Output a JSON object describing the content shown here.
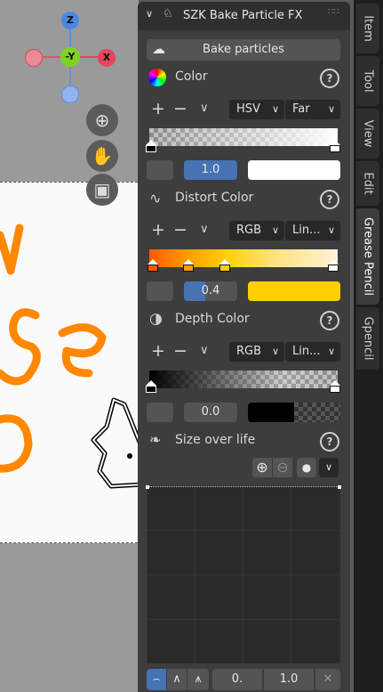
{
  "panel": {
    "title": "SZK Bake Particle FX",
    "bake_button": "Bake particles",
    "color": {
      "label": "Color",
      "mode": "HSV",
      "interpolation": "Far",
      "position_value": "1.0",
      "swatch_color": "#ffffff"
    },
    "distort_color": {
      "label": "Distort Color",
      "mode": "RGB",
      "interpolation": "Lin...",
      "position_value": "0.4",
      "swatch_color": "#ffcf00"
    },
    "depth_color": {
      "label": "Depth Color",
      "mode": "RGB",
      "interpolation": "Lin...",
      "position_value": "0.0",
      "swatch_color": "#000000"
    },
    "size_over_life": {
      "label": "Size over life",
      "min_value": "0.",
      "max_value": "1.0"
    }
  },
  "tabs": [
    "Item",
    "Tool",
    "View",
    "Edit",
    "Grease Pencil",
    "Gpencil"
  ],
  "active_tab": "Grease Pencil",
  "gizmo": {
    "z": "Z",
    "y": "-Y",
    "x": "X"
  },
  "colors": {
    "accent_blue": "#4772b3",
    "distort_yellow": "#ffcf00",
    "stroke_orange": "#ff8800"
  }
}
